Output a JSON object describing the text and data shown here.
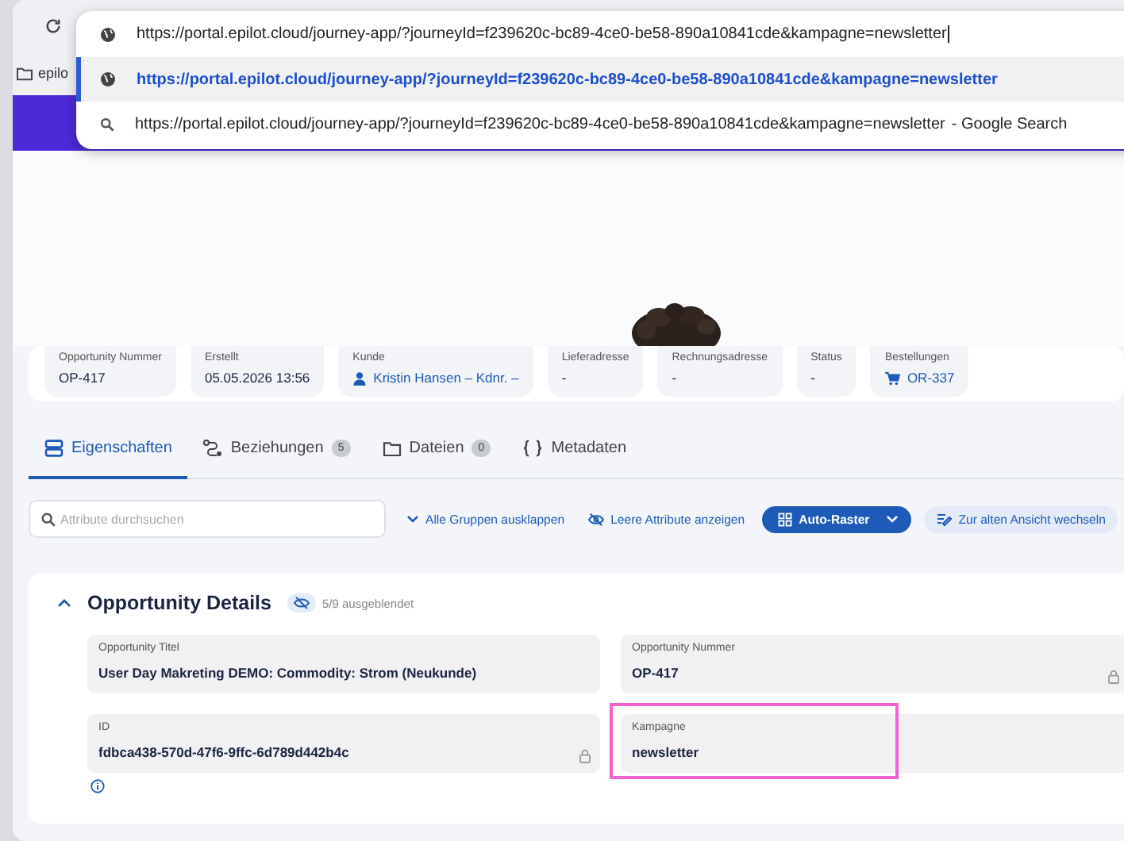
{
  "browser": {
    "bookmark": "epilo",
    "address_bar": {
      "value": "https://portal.epilot.cloud/journey-app/?journeyId=f239620c-bc89-4ce0-be58-890a10841cde&kampagne=newsletter"
    },
    "suggestions": [
      {
        "kind": "url",
        "text": "https://portal.epilot.cloud/journey-app/?journeyId=f239620c-bc89-4ce0-be58-890a10841cde&kampagne=newsletter",
        "selected": true
      },
      {
        "kind": "search",
        "text": "https://portal.epilot.cloud/journey-app/?journeyId=f239620c-bc89-4ce0-be58-890a10841cde&kampagne=newsletter",
        "suffix": "- Google Search",
        "selected": false
      }
    ]
  },
  "summary": [
    {
      "label": "Opportunity Nummer",
      "value": "OP-417"
    },
    {
      "label": "Erstellt",
      "value": "05.05.2026 13:56"
    },
    {
      "label": "Kunde",
      "value": "Kristin Hansen – Kdnr. –",
      "kind": "customer"
    },
    {
      "label": "Lieferadresse",
      "value": "-"
    },
    {
      "label": "Rechnungsadresse",
      "value": "-"
    },
    {
      "label": "Status",
      "value": "-"
    },
    {
      "label": "Bestellungen",
      "value": "OR-337",
      "kind": "order"
    }
  ],
  "tabs": [
    {
      "label": "Eigenschaften",
      "selected": true
    },
    {
      "label": "Beziehungen",
      "count": "5",
      "selected": false
    },
    {
      "label": "Dateien",
      "count": "0",
      "selected": false
    },
    {
      "label": "Metadaten",
      "selected": false
    }
  ],
  "search": {
    "placeholder": "Attribute durchsuchen"
  },
  "actions": [
    {
      "kind": "link",
      "label": "Alle Gruppen ausklappen"
    },
    {
      "kind": "link",
      "label": "Leere Attribute anzeigen"
    },
    {
      "kind": "primary",
      "label": "Auto-Raster"
    },
    {
      "kind": "secondary",
      "label": "Zur alten Ansicht wechseln"
    }
  ],
  "section": {
    "title": "Opportunity Details",
    "expanded": true,
    "hidden_badge": "5/9 ausgeblendet",
    "fields": [
      {
        "label": "Opportunity Titel",
        "value": "User Day Makreting DEMO: Commodity: Strom (Neukunde)",
        "locked": false,
        "highlighted": false
      },
      {
        "label": "Opportunity Nummer",
        "value": "OP-417",
        "locked": true,
        "highlighted": false
      },
      {
        "label": "ID",
        "value": "fdbca438-570d-47f6-9ffc-6d789d442b4c",
        "locked": true,
        "highlighted": false,
        "info": true
      },
      {
        "label": "Kampagne",
        "value": "newsletter",
        "locked": false,
        "highlighted": true
      }
    ]
  }
}
